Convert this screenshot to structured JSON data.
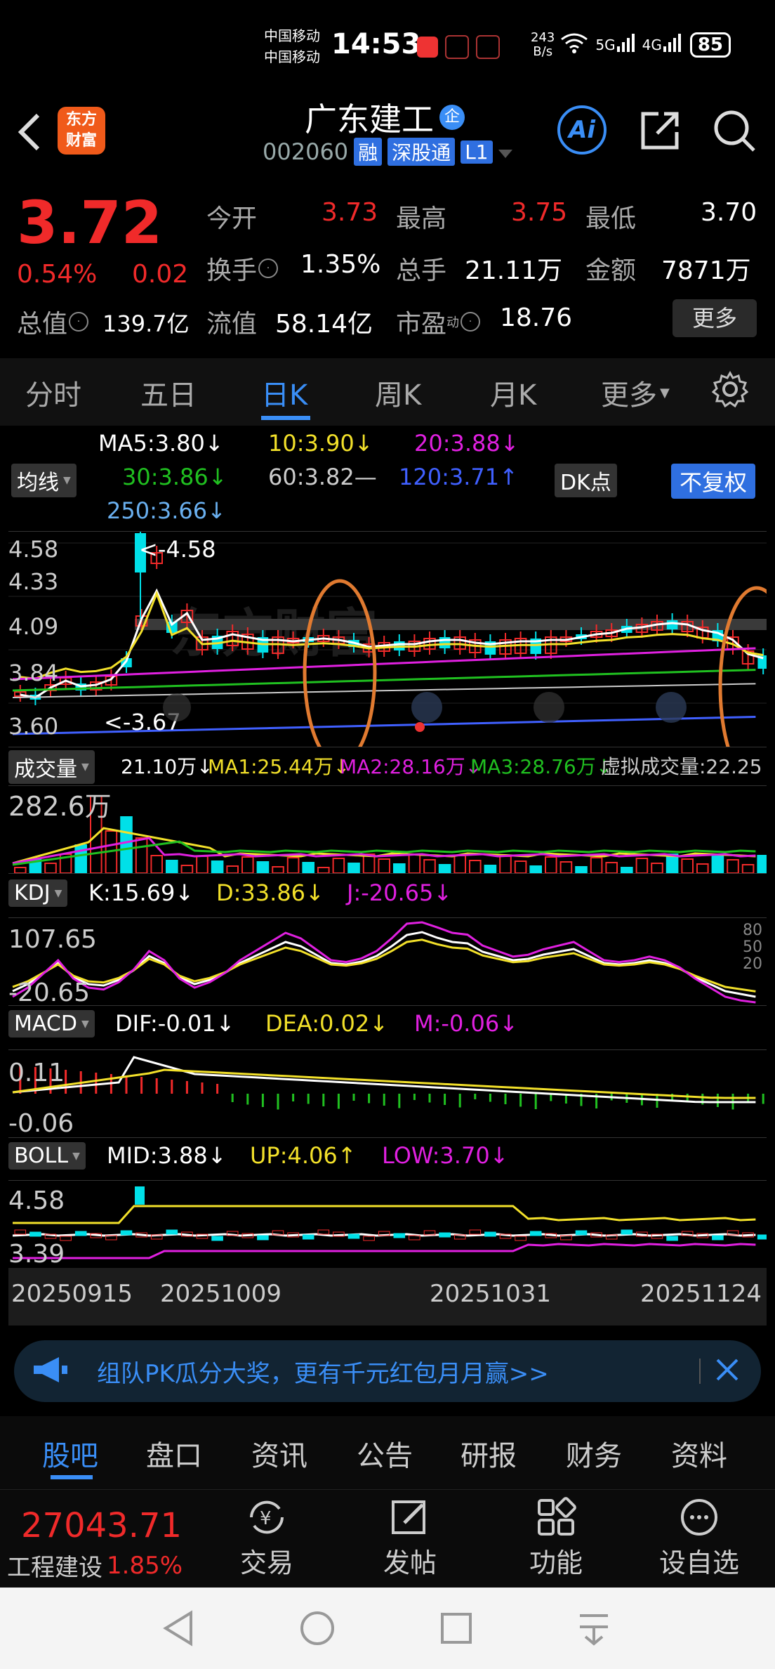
{
  "status": {
    "carrier1": "中国移动",
    "carrier2": "中国移动",
    "time": "14:53",
    "net_speed_top": "243",
    "net_speed_bottom": "B/s",
    "signal1": "5G",
    "signal2": "4G",
    "battery": "85"
  },
  "header": {
    "logo_line1": "东方",
    "logo_line2": "财富",
    "stock_name": "广东建工",
    "qi_badge": "企",
    "stock_code": "002060",
    "tag_rong": "融",
    "tag_sgt": "深股通",
    "tag_l1": "L1",
    "ai_label": "Ai"
  },
  "quote": {
    "price": "3.72",
    "change_pct": "0.54%",
    "change": "0.02",
    "open_label": "今开",
    "open": "3.73",
    "high_label": "最高",
    "high": "3.75",
    "low_label": "最低",
    "low": "3.70",
    "turnover_label": "换手",
    "turnover": "1.35%",
    "volume_label": "总手",
    "volume": "21.11万",
    "amount_label": "金额",
    "amount": "7871万",
    "mktcap_label": "总值",
    "mktcap": "139.7亿",
    "float_label": "流值",
    "float_cap": "58.14亿",
    "pe_label": "市盈",
    "pe_sup": "动",
    "pe": "18.76",
    "more": "更多"
  },
  "chart_tabs": [
    "分时",
    "五日",
    "日K",
    "周K",
    "月K",
    "更多"
  ],
  "ma": {
    "label": "均线",
    "ma5": "MA5:3.80↓",
    "ma10": "10:3.90↓",
    "ma20": "20:3.88↓",
    "ma30": "30:3.86↓",
    "ma60": "60:3.82—",
    "ma120": "120:3.71↑",
    "ma250": "250:3.66↓",
    "dk": "DK点",
    "fq": "不复权"
  },
  "kline": {
    "y1": "4.58",
    "y2": "4.33",
    "y3": "4.09",
    "y4": "3.84",
    "y5": "3.60",
    "max_label": "<-4.58",
    "min_label": "<-3.67",
    "watermark": "东方财富"
  },
  "volume": {
    "label": "成交量",
    "value": "21.10万↓",
    "ma1": "MA1:25.44万↓",
    "ma2": "MA2:28.16万↓",
    "ma3": "MA3:28.76万↓",
    "virtual": "虚拟成交量:22.25万",
    "y_top": "282.6万"
  },
  "kdj": {
    "label": "KDJ",
    "k": "K:15.69↓",
    "d": "D:33.86↓",
    "j": "J:-20.65↓",
    "y_top": "107.65",
    "y_bottom": "-20.65",
    "r80": "80",
    "r50": "50",
    "r20": "20"
  },
  "macd": {
    "label": "MACD",
    "dif": "DIF:-0.01↓",
    "dea": "DEA:0.02↓",
    "m": "M:-0.06↓",
    "y_top": "0.11",
    "y_bottom": "-0.06"
  },
  "boll": {
    "label": "BOLL",
    "mid": "MID:3.88↓",
    "up": "UP:4.06↑",
    "low": "LOW:3.70↓",
    "y_top": "4.58",
    "y_bottom": "3.39"
  },
  "dates": [
    "20250915",
    "20251009",
    "20251031",
    "20251124"
  ],
  "banner": {
    "text": "组队PK瓜分大奖，更有千元红包月月赢>>"
  },
  "bottom_tabs": [
    "股吧",
    "盘口",
    "资讯",
    "公告",
    "研报",
    "财务",
    "资料"
  ],
  "bottom_bar": {
    "index_value": "27043.71",
    "index_name": "工程建设",
    "index_pct": "1.85%",
    "trade": "交易",
    "post": "发帖",
    "func": "功能",
    "watch": "设自选",
    "yen": "¥"
  },
  "colors": {
    "up": "#f02a2a",
    "down": "#00e0e8",
    "accent": "#3a8ef6",
    "ma5": "#ffffff",
    "ma10": "#f2e02a",
    "ma20": "#e020e0",
    "ma30": "#20c020",
    "ma120": "#4060ff"
  }
}
